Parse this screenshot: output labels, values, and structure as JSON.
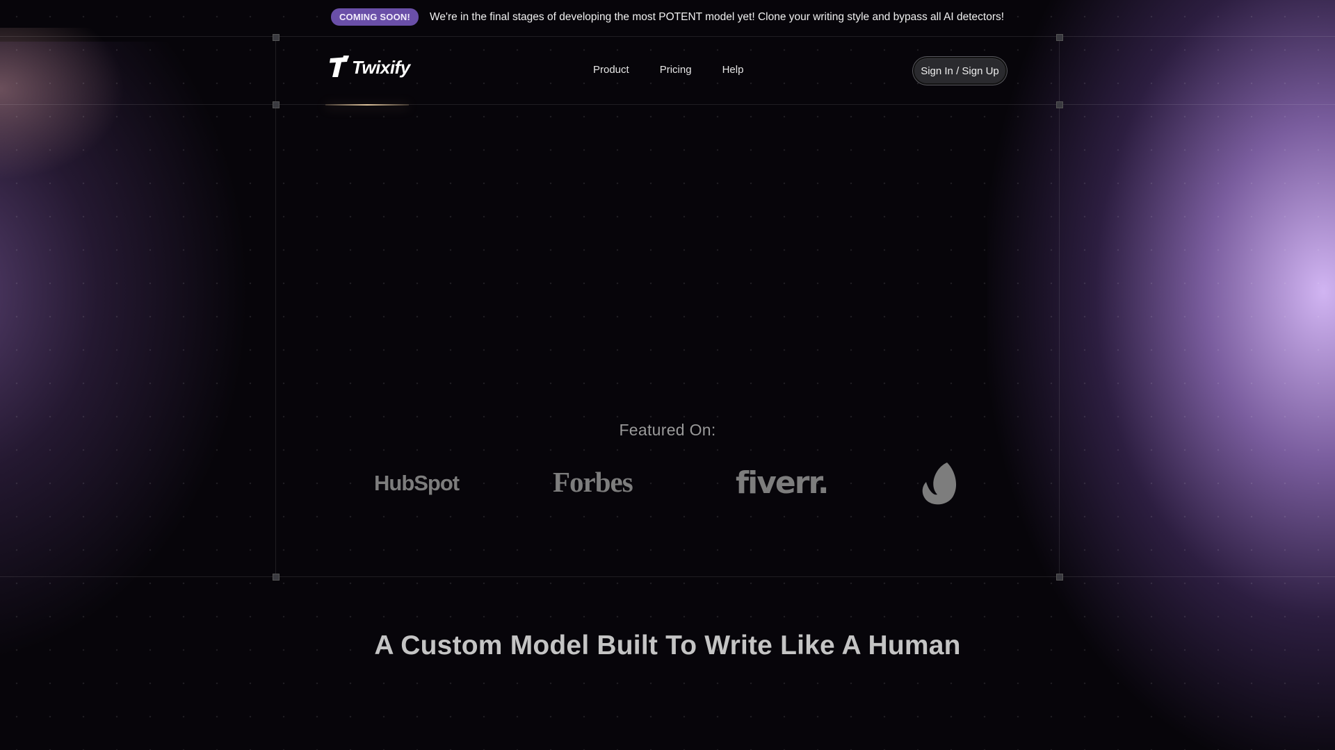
{
  "announcement": {
    "badge": "COMING SOON!",
    "text": "We're in the final stages of developing the most POTENT model yet! Clone your writing style and bypass all AI detectors!"
  },
  "header": {
    "logo_text": "Twixify",
    "nav": [
      {
        "label": "Product"
      },
      {
        "label": "Pricing"
      },
      {
        "label": "Help"
      }
    ],
    "signin_label": "Sign In / Sign Up"
  },
  "featured": {
    "title": "Featured On:",
    "logos": [
      "HubSpot",
      "Forbes",
      "fiverr.",
      "envato-icon"
    ]
  },
  "section": {
    "headline": "A Custom Model Built To Write Like A Human"
  },
  "colors": {
    "background": "#07050a",
    "badge": "#6a4fa8",
    "right_glow": "#dcbeff"
  }
}
